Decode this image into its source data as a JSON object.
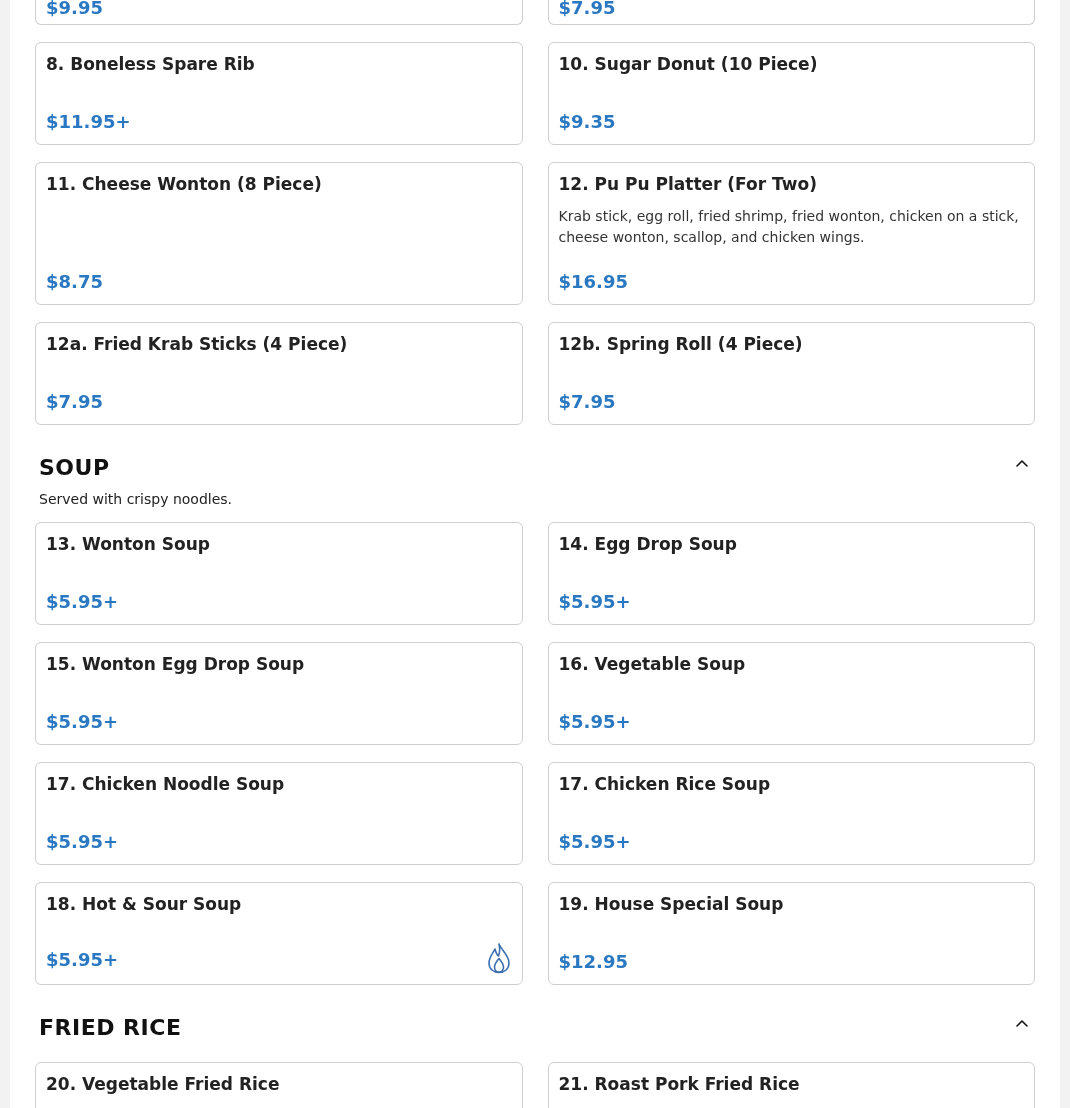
{
  "sections": [
    {
      "items": [
        {
          "price": "$9.95",
          "spicy": false
        },
        {
          "price": "$7.95",
          "spicy": false
        },
        {
          "name": "8. Boneless Spare Rib",
          "price": "$11.95+",
          "spicy": false
        },
        {
          "name": "10. Sugar Donut (10 Piece)",
          "price": "$9.35",
          "spicy": false
        },
        {
          "name": "11. Cheese Wonton (8 Piece)",
          "price": "$8.75",
          "spicy": false
        },
        {
          "name": "12. Pu Pu Platter (For Two)",
          "description": "Krab stick, egg roll, fried shrimp, fried wonton, chicken on a stick, cheese wonton, scallop, and chicken wings.",
          "price": "$16.95",
          "spicy": false
        },
        {
          "name": "12a. Fried Krab Sticks (4 Piece)",
          "price": "$7.95",
          "spicy": false
        },
        {
          "name": "12b. Spring Roll (4 Piece)",
          "price": "$7.95",
          "spicy": false
        }
      ]
    },
    {
      "title": "SOUP",
      "description": "Served with crispy noodles.",
      "expanded": true,
      "items": [
        {
          "name": "13. Wonton Soup",
          "price": "$5.95+",
          "spicy": false
        },
        {
          "name": "14. Egg Drop Soup",
          "price": "$5.95+",
          "spicy": false
        },
        {
          "name": "15. Wonton Egg Drop Soup",
          "price": "$5.95+",
          "spicy": false
        },
        {
          "name": "16. Vegetable Soup",
          "price": "$5.95+",
          "spicy": false
        },
        {
          "name": "17. Chicken Noodle Soup",
          "price": "$5.95+",
          "spicy": false
        },
        {
          "name": "17. Chicken Rice Soup",
          "price": "$5.95+",
          "spicy": false
        },
        {
          "name": "18. Hot & Sour Soup",
          "price": "$5.95+",
          "spicy": true
        },
        {
          "name": "19. House Special Soup",
          "price": "$12.95",
          "spicy": false
        }
      ]
    },
    {
      "title": "FRIED RICE",
      "expanded": true,
      "items": [
        {
          "name": "20. Vegetable Fried Rice",
          "spicy": false
        },
        {
          "name": "21. Roast Pork Fried Rice",
          "spicy": false
        }
      ]
    }
  ]
}
